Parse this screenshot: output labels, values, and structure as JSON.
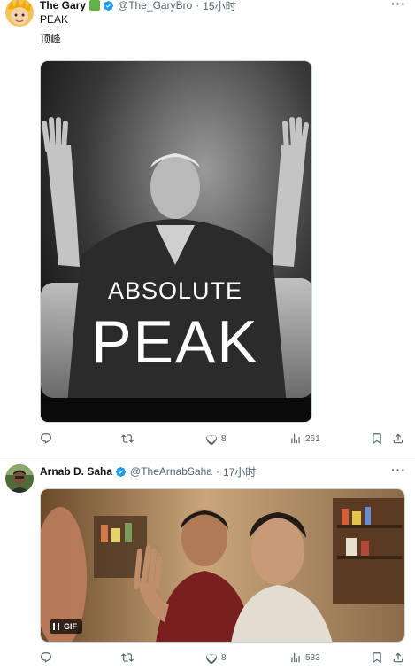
{
  "tweets": [
    {
      "author": {
        "name": "The Gary",
        "handle": "@The_GaryBro",
        "time": "15小时"
      },
      "text_lines": [
        "PEAK",
        "顶峰"
      ],
      "media": {
        "overlay_line1": "ABSOLUTE",
        "overlay_line2": "PEAK"
      },
      "actions": {
        "reply_count": "",
        "repost_count": "",
        "like_count": "8",
        "views_count": "261"
      }
    },
    {
      "author": {
        "name": "Arnab D. Saha",
        "handle": "@TheArnabSaha",
        "time": "17小时"
      },
      "media": {
        "badge_label": "GIF"
      },
      "actions": {
        "reply_count": "",
        "repost_count": "",
        "like_count": "8",
        "views_count": "533"
      }
    }
  ],
  "separator": "·",
  "icons": [
    "reply-icon",
    "repost-icon",
    "like-icon",
    "views-icon",
    "bookmark-icon",
    "share-icon",
    "more-icon",
    "verified-icon",
    "pause-icon"
  ],
  "colors": {
    "verified": "#1d9bf0",
    "secondary_text": "#536471",
    "green_badge": "#5fb247"
  }
}
